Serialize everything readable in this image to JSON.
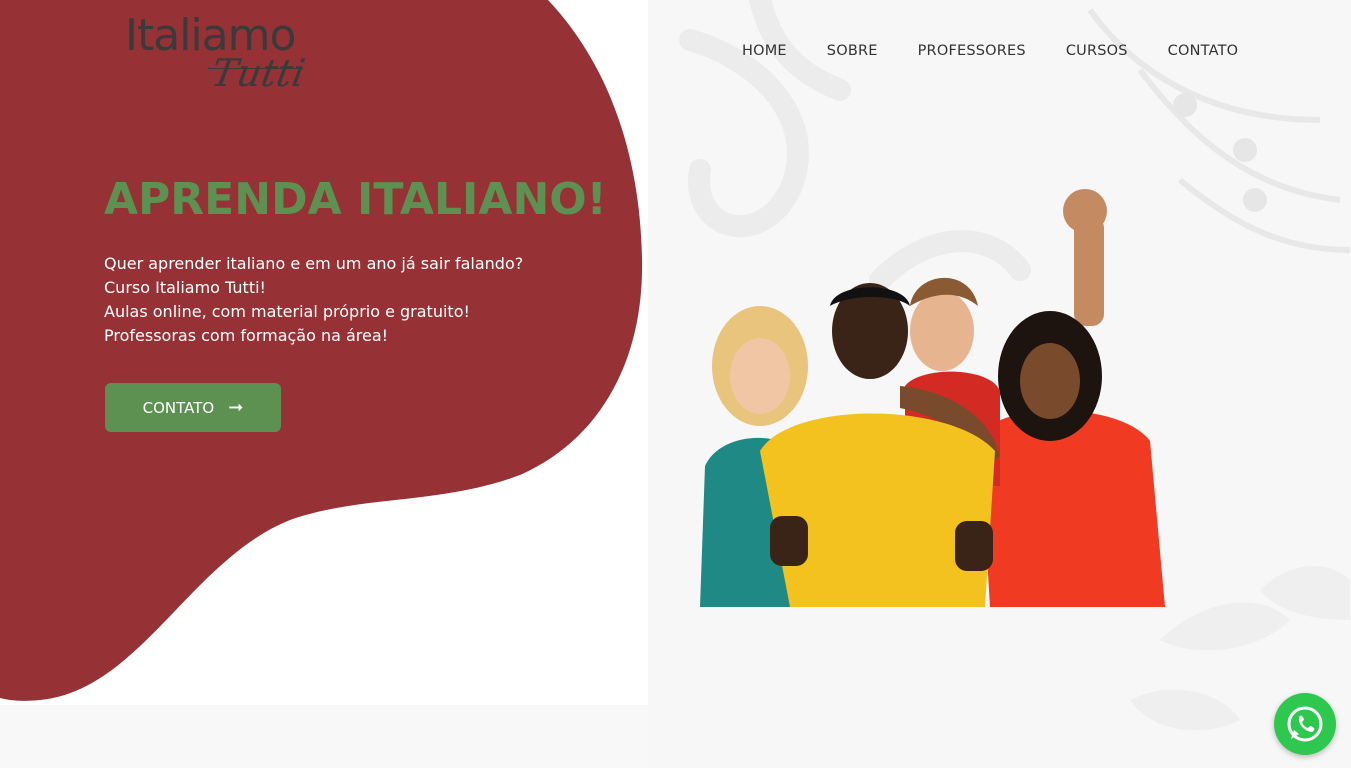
{
  "logo": {
    "main": "Italiamo",
    "sub": "Tutti"
  },
  "nav": {
    "items": [
      {
        "label": "HOME"
      },
      {
        "label": "SOBRE"
      },
      {
        "label": "PROFESSORES"
      },
      {
        "label": "CURSOS"
      },
      {
        "label": "CONTATO"
      }
    ]
  },
  "hero": {
    "title": "APRENDA ITALIANO!",
    "lines": [
      "Quer aprender italiano e em um ano já sair falando?",
      "Curso Italiamo Tutti!",
      "Aulas online, com material próprio e gratuito!",
      "Professoras com formação na área!"
    ],
    "cta_label": "CONTATO"
  },
  "colors": {
    "blob": "#963135",
    "accent_green": "#5d9152",
    "whatsapp": "#2fc84f"
  },
  "icons": {
    "cta": "arrow-right-icon",
    "floating": "whatsapp-icon"
  }
}
